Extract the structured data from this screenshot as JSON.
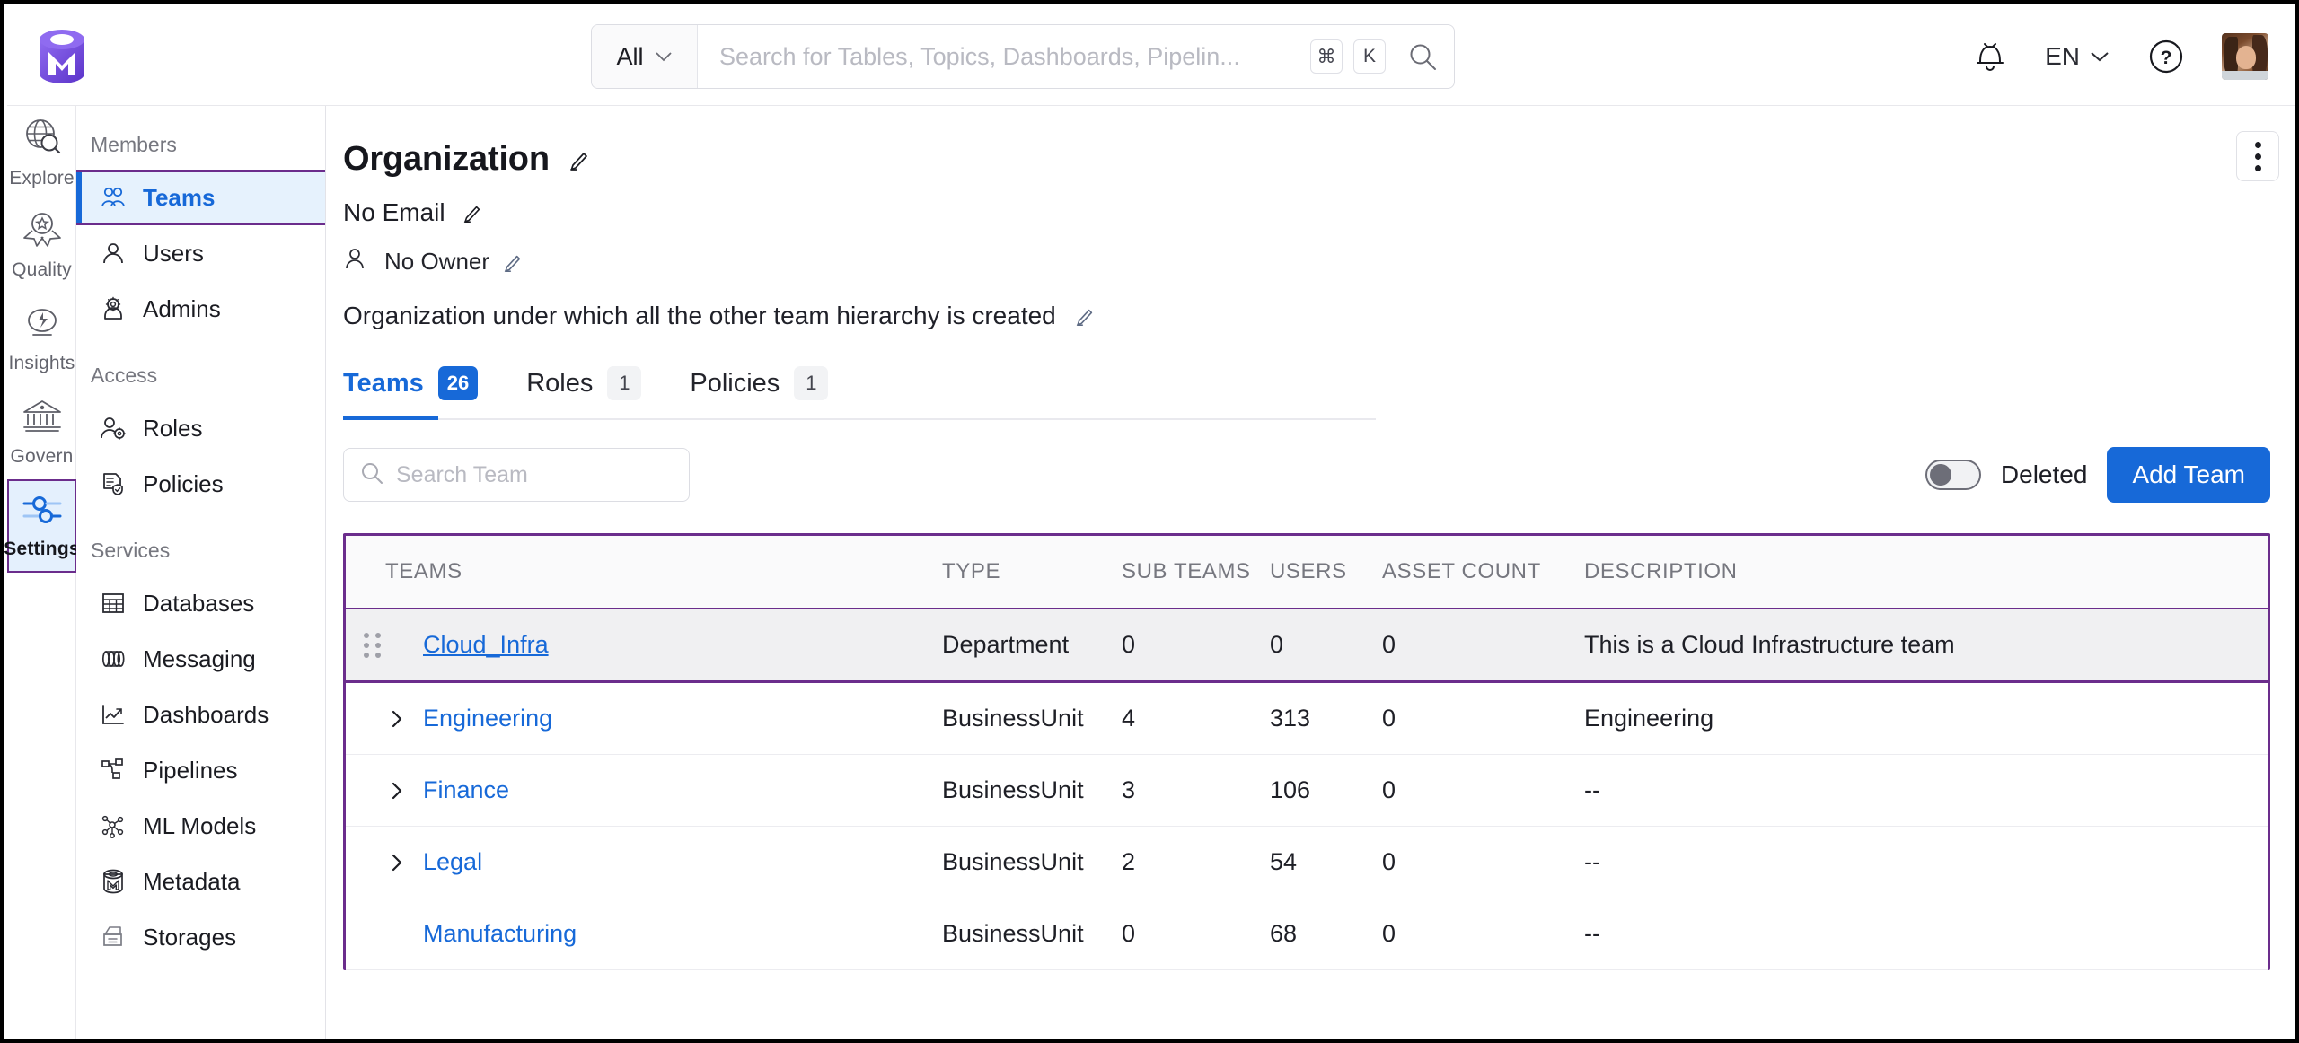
{
  "topbar": {
    "logo_name": "openmetadata-logo",
    "search": {
      "scope_label": "All",
      "placeholder": "Search for Tables, Topics, Dashboards, Pipelin...",
      "kbd_mod": "⌘",
      "kbd_key": "K"
    },
    "notifications_label": "bell-icon",
    "language": "EN",
    "help_label": "?",
    "avatar_label": "user-avatar"
  },
  "rail": {
    "items": [
      {
        "label": "Explore",
        "icon": "globe-search-icon",
        "active": false
      },
      {
        "label": "Quality",
        "icon": "award-ribbon-icon",
        "active": false
      },
      {
        "label": "Insights",
        "icon": "speech-bolt-icon",
        "active": false
      },
      {
        "label": "Govern",
        "icon": "bank-icon",
        "active": false
      },
      {
        "label": "Settings",
        "icon": "sliders-icon",
        "active": true
      }
    ]
  },
  "subnav": {
    "groups": [
      {
        "title": "Members",
        "items": [
          {
            "label": "Teams",
            "icon": "people-icon",
            "active": true
          },
          {
            "label": "Users",
            "icon": "person-icon",
            "active": false
          },
          {
            "label": "Admins",
            "icon": "admin-gear-icon",
            "active": false
          }
        ]
      },
      {
        "title": "Access",
        "items": [
          {
            "label": "Roles",
            "icon": "role-gear-icon",
            "active": false
          },
          {
            "label": "Policies",
            "icon": "policy-shield-icon",
            "active": false
          }
        ]
      },
      {
        "title": "Services",
        "items": [
          {
            "label": "Databases",
            "icon": "table-grid-icon",
            "active": false
          },
          {
            "label": "Messaging",
            "icon": "topic-icon",
            "active": false
          },
          {
            "label": "Dashboards",
            "icon": "line-chart-icon",
            "active": false
          },
          {
            "label": "Pipelines",
            "icon": "pipeline-icon",
            "active": false
          },
          {
            "label": "ML Models",
            "icon": "ml-model-icon",
            "active": false
          },
          {
            "label": "Metadata",
            "icon": "metadata-icon",
            "active": false
          },
          {
            "label": "Storages",
            "icon": "storage-icon",
            "active": false
          }
        ]
      }
    ]
  },
  "main": {
    "title": "Organization",
    "email": "No Email",
    "owner": "No Owner",
    "description": "Organization under which all the other team hierarchy is created",
    "kebab_label": "more-options",
    "tabs": [
      {
        "label": "Teams",
        "count": "26",
        "active": true
      },
      {
        "label": "Roles",
        "count": "1",
        "active": false
      },
      {
        "label": "Policies",
        "count": "1",
        "active": false
      }
    ],
    "toolbar": {
      "search_placeholder": "Search Team",
      "deleted_label": "Deleted",
      "deleted_on": false,
      "add_team_label": "Add Team"
    },
    "table": {
      "columns": [
        "TEAMS",
        "TYPE",
        "SUB TEAMS",
        "USERS",
        "ASSET COUNT",
        "DESCRIPTION"
      ],
      "rows": [
        {
          "team": "Cloud_Infra",
          "type": "Department",
          "sub_teams": "0",
          "users": "0",
          "asset_count": "0",
          "description": "This is a Cloud Infrastructure team",
          "highlight": true,
          "expandable": false,
          "drag": true
        },
        {
          "team": "Engineering",
          "type": "BusinessUnit",
          "sub_teams": "4",
          "users": "313",
          "asset_count": "0",
          "description": "Engineering",
          "highlight": false,
          "expandable": true,
          "drag": false
        },
        {
          "team": "Finance",
          "type": "BusinessUnit",
          "sub_teams": "3",
          "users": "106",
          "asset_count": "0",
          "description": "--",
          "highlight": false,
          "expandable": true,
          "drag": false
        },
        {
          "team": "Legal",
          "type": "BusinessUnit",
          "sub_teams": "2",
          "users": "54",
          "asset_count": "0",
          "description": "--",
          "highlight": false,
          "expandable": true,
          "drag": false
        },
        {
          "team": "Manufacturing",
          "type": "BusinessUnit",
          "sub_teams": "0",
          "users": "68",
          "asset_count": "0",
          "description": "--",
          "highlight": false,
          "expandable": false,
          "drag": false
        }
      ]
    }
  },
  "colors": {
    "brand_purple": "#7147e8",
    "accent_blue": "#1769d8",
    "highlight_border": "#6b2d8c",
    "active_bg": "#e4f0fd",
    "row_highlight_bg": "#f0f0f2"
  }
}
